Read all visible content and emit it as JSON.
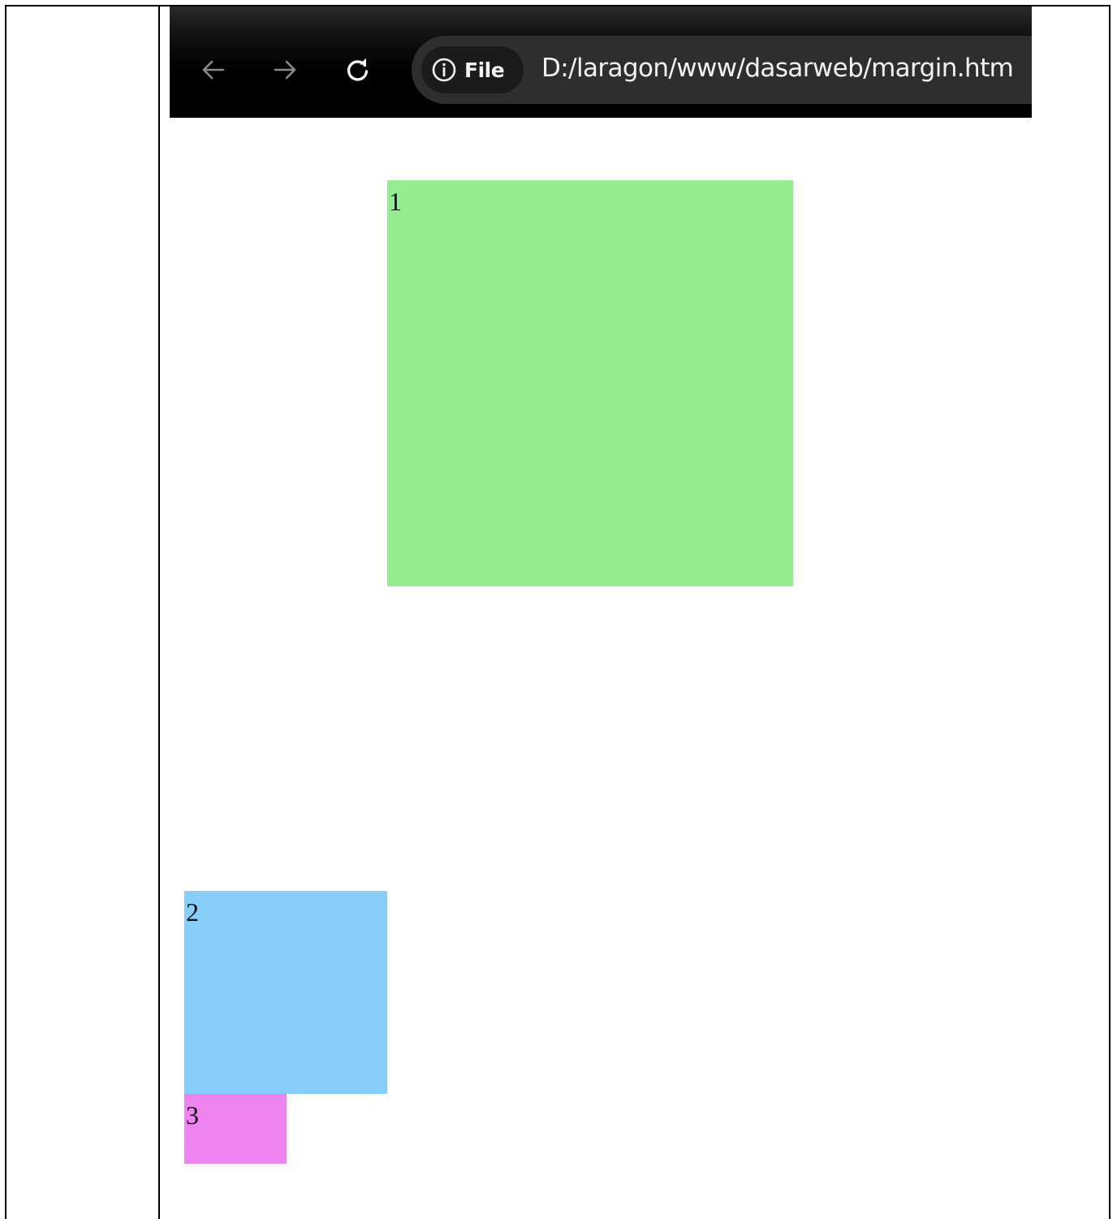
{
  "browser": {
    "nav": {
      "back_icon": "arrow-left-icon",
      "forward_icon": "arrow-right-icon",
      "reload_icon": "reload-icon"
    },
    "address_bar": {
      "site_info_icon": "info-circle-icon",
      "site_info_label": "File",
      "url": "D:/laragon/www/dasarweb/margin.htm"
    }
  },
  "page": {
    "boxes": [
      {
        "label": "1",
        "color": "#94ee91"
      },
      {
        "label": "2",
        "color": "#87cef8"
      },
      {
        "label": "3",
        "color": "#ee82ee"
      }
    ]
  },
  "colors": {
    "toolbar_background": "#000000",
    "omnibox_background": "#2e2e2e",
    "chip_background": "#1b1b1b",
    "toolbar_text": "#f2f2f2",
    "disabled_icon": "#8a8a8a"
  }
}
